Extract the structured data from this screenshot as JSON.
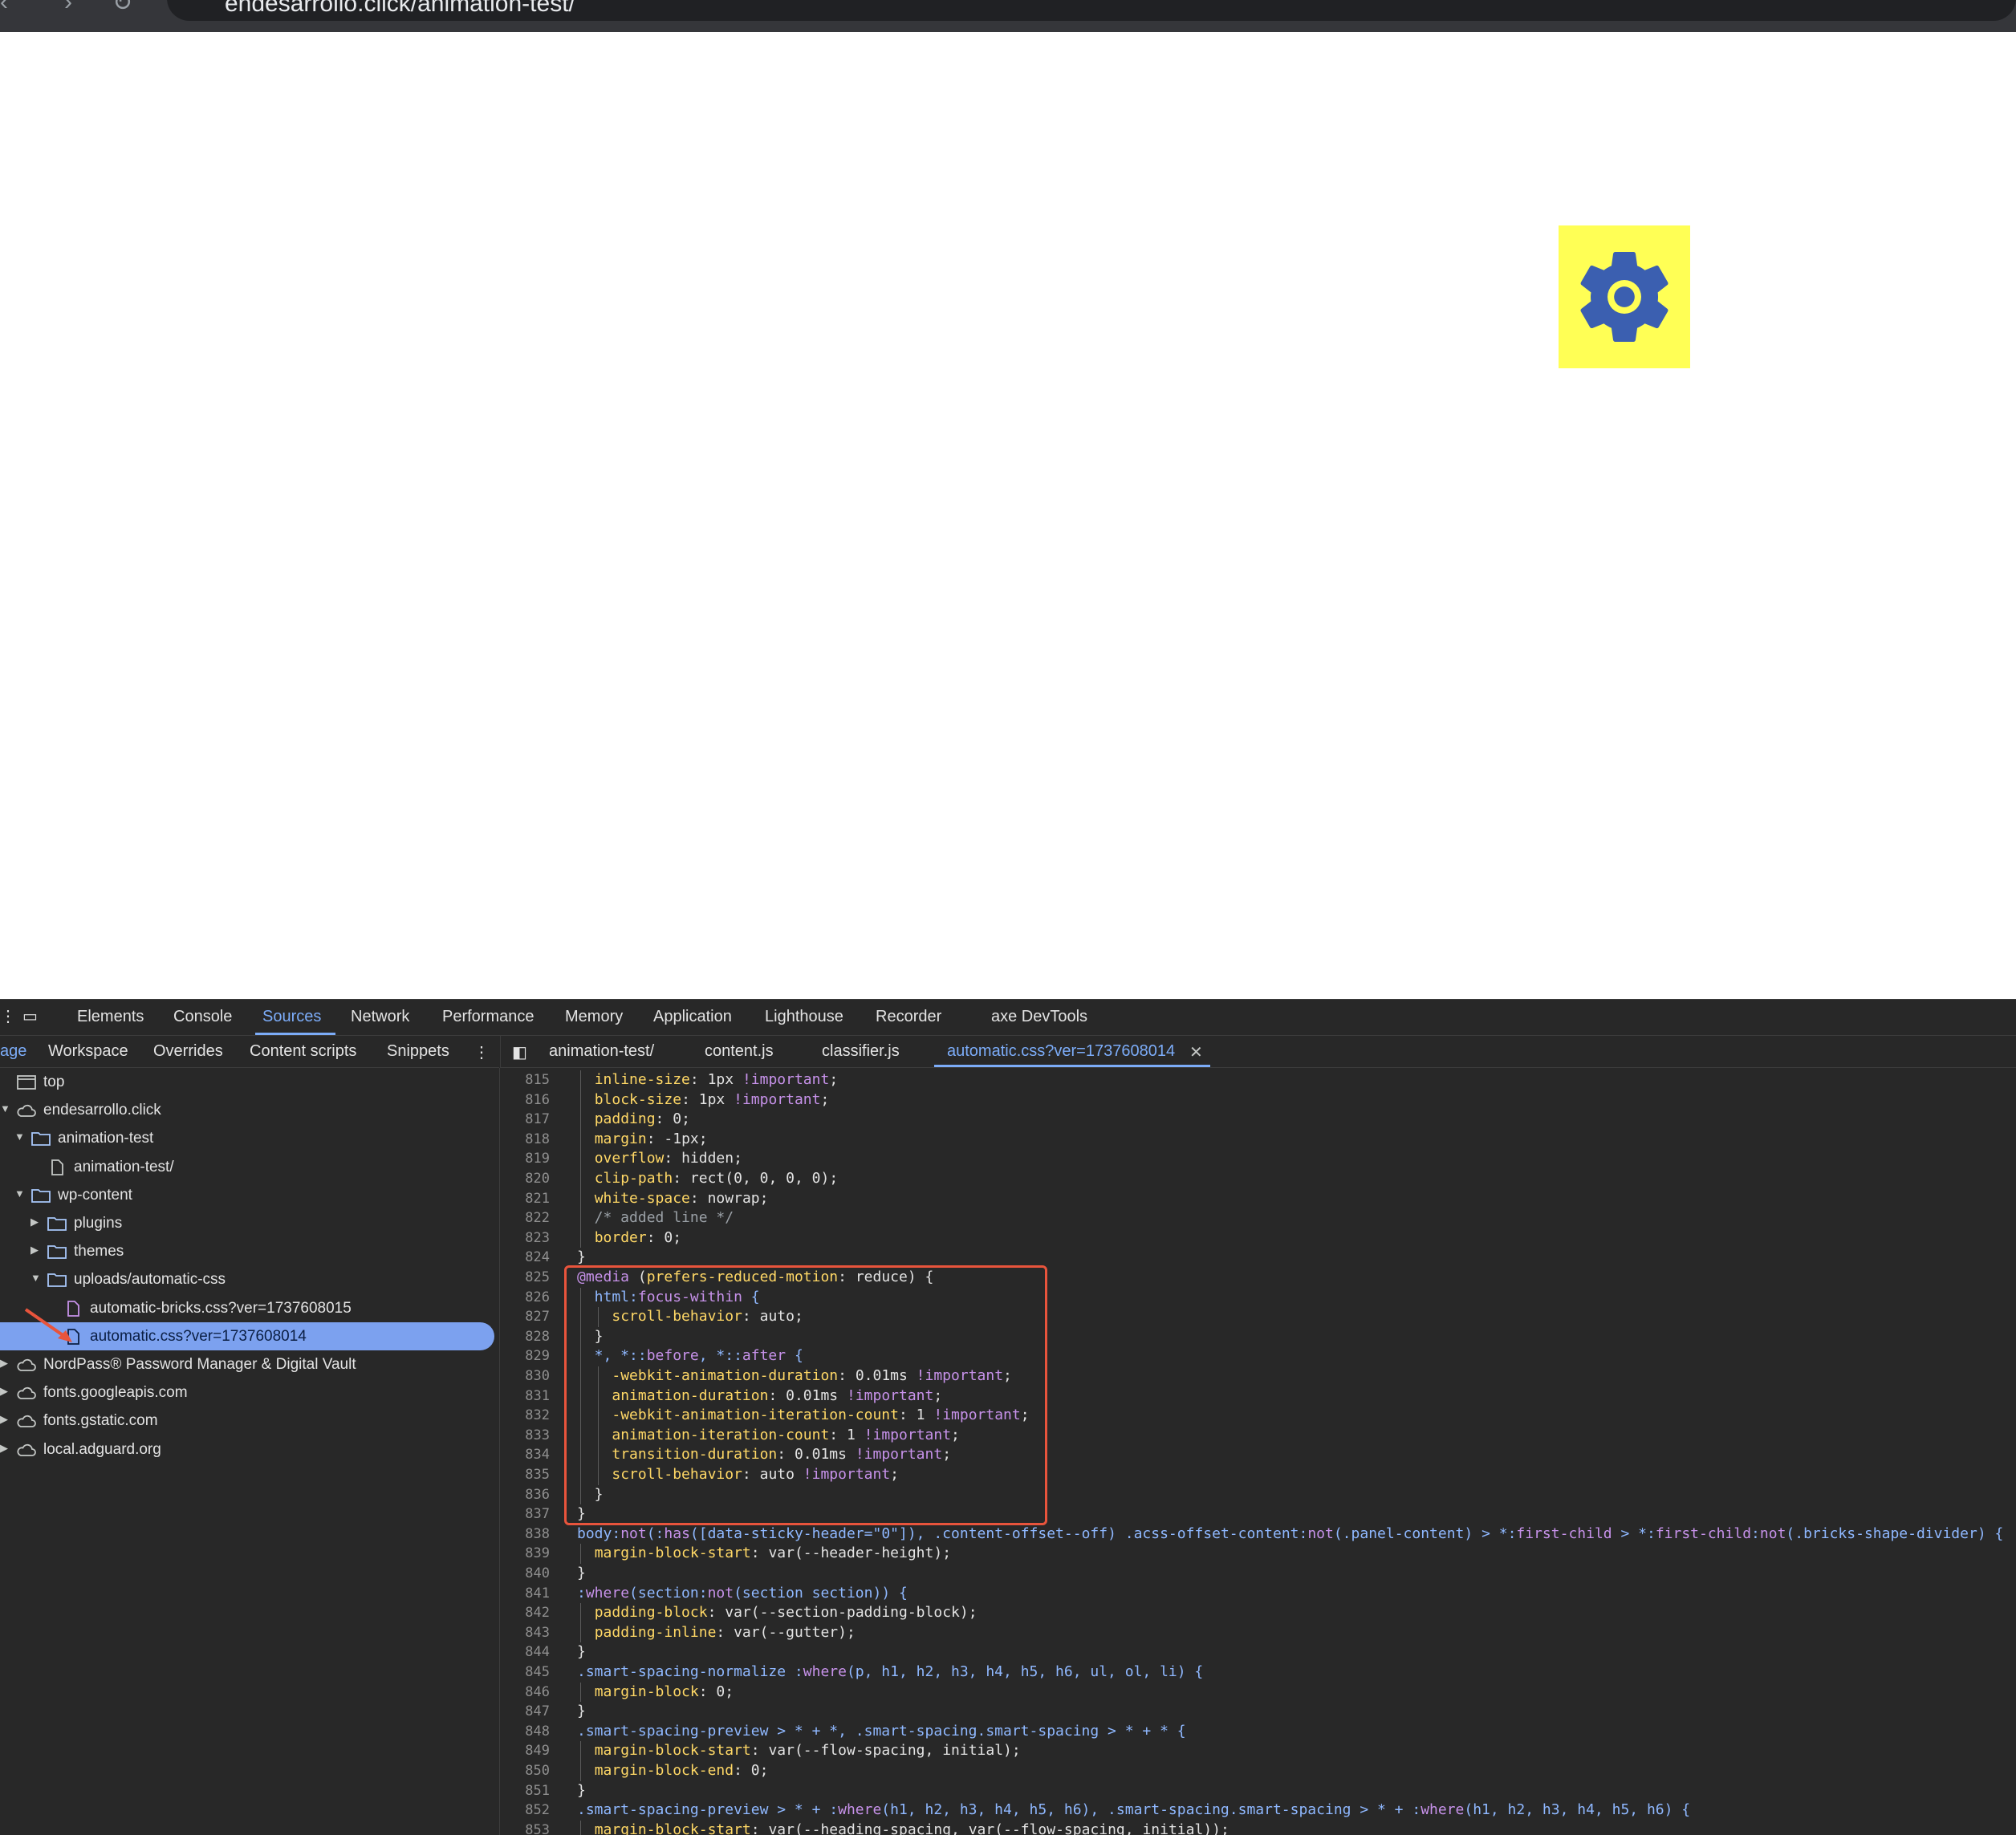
{
  "browser": {
    "address": "endesarrollo.click/animation-test/"
  },
  "devtools": {
    "main_tabs": [
      "Elements",
      "Console",
      "Sources",
      "Network",
      "Performance",
      "Memory",
      "Application",
      "Lighthouse",
      "Recorder",
      "axe DevTools"
    ],
    "active_main_tab": "Sources",
    "sub_tabs": [
      "age",
      "Workspace",
      "Overrides",
      "Content scripts",
      "Snippets"
    ],
    "file_tabs": [
      "animation-test/",
      "content.js",
      "classifier.js",
      "automatic.css?ver=1737608014"
    ],
    "active_file_tab": "automatic.css?ver=1737608014",
    "tree": [
      {
        "label": "top",
        "type": "frame",
        "level": 0
      },
      {
        "label": "endesarrollo.click",
        "type": "domain",
        "level": 0,
        "expanded": true
      },
      {
        "label": "animation-test",
        "type": "folder",
        "level": 1,
        "expanded": true
      },
      {
        "label": "animation-test/",
        "type": "file",
        "level": 2
      },
      {
        "label": "wp-content",
        "type": "folder",
        "level": 1,
        "expanded": true
      },
      {
        "label": "plugins",
        "type": "folder",
        "level": 2,
        "expanded": false
      },
      {
        "label": "themes",
        "type": "folder",
        "level": 2,
        "expanded": false
      },
      {
        "label": "uploads/automatic-css",
        "type": "folder",
        "level": 2,
        "expanded": true
      },
      {
        "label": "automatic-bricks.css?ver=1737608015",
        "type": "file-css",
        "level": 3
      },
      {
        "label": "automatic.css?ver=1737608014",
        "type": "file-css",
        "level": 3,
        "selected": true
      },
      {
        "label": "NordPass® Password Manager & Digital Vault",
        "type": "domain",
        "level": 0,
        "expanded": false
      },
      {
        "label": "fonts.googleapis.com",
        "type": "domain",
        "level": 0,
        "expanded": false
      },
      {
        "label": "fonts.gstatic.com",
        "type": "domain",
        "level": 0,
        "expanded": false
      },
      {
        "label": "local.adguard.org",
        "type": "domain",
        "level": 0,
        "expanded": false
      }
    ],
    "code_lines": [
      {
        "n": "815",
        "text": "  inline-size: 1px !important;"
      },
      {
        "n": "816",
        "text": "  block-size: 1px !important;"
      },
      {
        "n": "817",
        "text": "  padding: 0;"
      },
      {
        "n": "818",
        "text": "  margin: -1px;"
      },
      {
        "n": "819",
        "text": "  overflow: hidden;"
      },
      {
        "n": "820",
        "text": "  clip-path: rect(0, 0, 0, 0);"
      },
      {
        "n": "821",
        "text": "  white-space: nowrap;"
      },
      {
        "n": "822",
        "text": "  /* added line */"
      },
      {
        "n": "823",
        "text": "  border: 0;"
      },
      {
        "n": "824",
        "text": "}"
      },
      {
        "n": "825",
        "text": "@media (prefers-reduced-motion: reduce) {"
      },
      {
        "n": "826",
        "text": "  html:focus-within {"
      },
      {
        "n": "827",
        "text": "    scroll-behavior: auto;"
      },
      {
        "n": "828",
        "text": "  }"
      },
      {
        "n": "829",
        "text": "  *, *::before, *::after {"
      },
      {
        "n": "830",
        "text": "    -webkit-animation-duration: 0.01ms !important;"
      },
      {
        "n": "831",
        "text": "    animation-duration: 0.01ms !important;"
      },
      {
        "n": "832",
        "text": "    -webkit-animation-iteration-count: 1 !important;"
      },
      {
        "n": "833",
        "text": "    animation-iteration-count: 1 !important;"
      },
      {
        "n": "834",
        "text": "    transition-duration: 0.01ms !important;"
      },
      {
        "n": "835",
        "text": "    scroll-behavior: auto !important;"
      },
      {
        "n": "836",
        "text": "  }"
      },
      {
        "n": "837",
        "text": "}"
      },
      {
        "n": "838",
        "text": "body:not(:has([data-sticky-header=\"0\"]), .content-offset--off) .acss-offset-content:not(.panel-content) > *:first-child > *:first-child:not(.bricks-shape-divider) {"
      },
      {
        "n": "839",
        "text": "  margin-block-start: var(--header-height);"
      },
      {
        "n": "840",
        "text": "}"
      },
      {
        "n": "841",
        "text": ":where(section:not(section section)) {"
      },
      {
        "n": "842",
        "text": "  padding-block: var(--section-padding-block);"
      },
      {
        "n": "843",
        "text": "  padding-inline: var(--gutter);"
      },
      {
        "n": "844",
        "text": "}"
      },
      {
        "n": "845",
        "text": ".smart-spacing-normalize :where(p, h1, h2, h3, h4, h5, h6, ul, ol, li) {"
      },
      {
        "n": "846",
        "text": "  margin-block: 0;"
      },
      {
        "n": "847",
        "text": "}"
      },
      {
        "n": "848",
        "text": ".smart-spacing-preview > * + *, .smart-spacing.smart-spacing > * + * {"
      },
      {
        "n": "849",
        "text": "  margin-block-start: var(--flow-spacing, initial);"
      },
      {
        "n": "850",
        "text": "  margin-block-end: 0;"
      },
      {
        "n": "851",
        "text": "}"
      },
      {
        "n": "852",
        "text": ".smart-spacing-preview > * + :where(h1, h2, h3, h4, h5, h6), .smart-spacing.smart-spacing > * + :where(h1, h2, h3, h4, h5, h6) {"
      },
      {
        "n": "853",
        "text": "  margin-block-start: var(--heading-spacing, var(--flow-spacing, initial));"
      }
    ]
  },
  "colors": {
    "gear_bg": "#ffff55",
    "gear_fg": "#3b5fb0",
    "highlight": "#e8543c",
    "accent": "#7cacf8"
  }
}
